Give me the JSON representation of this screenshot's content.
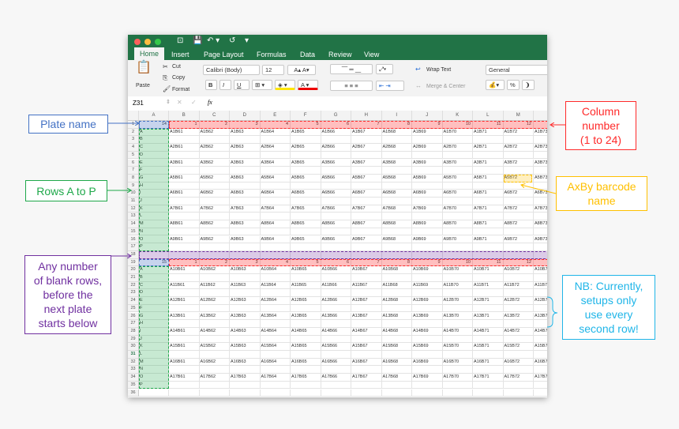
{
  "window": {
    "quick_access": [
      "⊡",
      "💾",
      "↶ ▾",
      "↺",
      "▾"
    ],
    "tabs": [
      "Home",
      "Insert",
      "Page Layout",
      "Formulas",
      "Data",
      "Review",
      "View"
    ],
    "active_tab": "Home"
  },
  "ribbon": {
    "paste": "Paste",
    "cut": "Cut",
    "copy": "Copy",
    "format": "Format",
    "font_name": "Calibri (Body)",
    "font_size": "12",
    "bold": "B",
    "italic": "I",
    "underline": "U",
    "wrap_text": "Wrap Text",
    "merge_center": "Merge & Center",
    "number_format": "General",
    "percent": "%"
  },
  "formula_bar": {
    "name_box": "Z31",
    "fx": "fx",
    "value": ""
  },
  "columns": [
    "A",
    "B",
    "C",
    "D",
    "E",
    "F",
    "G",
    "H",
    "I",
    "J",
    "K",
    "L",
    "M",
    "N"
  ],
  "row_letters": [
    "A",
    "B",
    "C",
    "D",
    "E",
    "F",
    "G",
    "H",
    "I",
    "J",
    "K",
    "L",
    "M",
    "N",
    "O",
    "P"
  ],
  "plates": [
    {
      "name": "14",
      "barcode_rows": [
        "A1",
        "",
        "A2",
        "",
        "A3",
        "",
        "A5",
        "",
        "A6",
        "",
        "A7",
        "",
        "A8",
        "",
        "A9",
        ""
      ]
    },
    {
      "name": "15",
      "barcode_rows": [
        "A10",
        "",
        "A11",
        "",
        "A12",
        "",
        "A13",
        "",
        "A14",
        "",
        "A15",
        "",
        "A16",
        "",
        "A17",
        ""
      ]
    }
  ],
  "column_numbers": [
    "1",
    "2",
    "3",
    "4",
    "5",
    "6",
    "7",
    "8",
    "9",
    "10",
    "11",
    "12"
  ],
  "barcode_suffixes": [
    "B61",
    "B62",
    "B63",
    "B64",
    "B65",
    "B66",
    "B67",
    "B68",
    "B69",
    "B70",
    "B71",
    "B72",
    "B73"
  ],
  "annotations": {
    "plate_name": "Plate name",
    "column_number": [
      "Column",
      "number",
      "(1 to 24)"
    ],
    "rows": "Rows A to P",
    "barcode": [
      "AxBy barcode",
      "name"
    ],
    "blank_rows": [
      "Any number",
      "of blank rows,",
      "before the",
      "next plate",
      "starts below"
    ],
    "nb": [
      "NB: Currently,",
      "setups only",
      "use every",
      "second row!"
    ]
  },
  "colors": {
    "excel_green": "#217346",
    "plate": "#4472c4",
    "columns": "#ff2a2a",
    "rows": "#1fa84a",
    "barcode": "#ffc000",
    "blank": "#7030a0",
    "nb": "#1fb5e8"
  }
}
